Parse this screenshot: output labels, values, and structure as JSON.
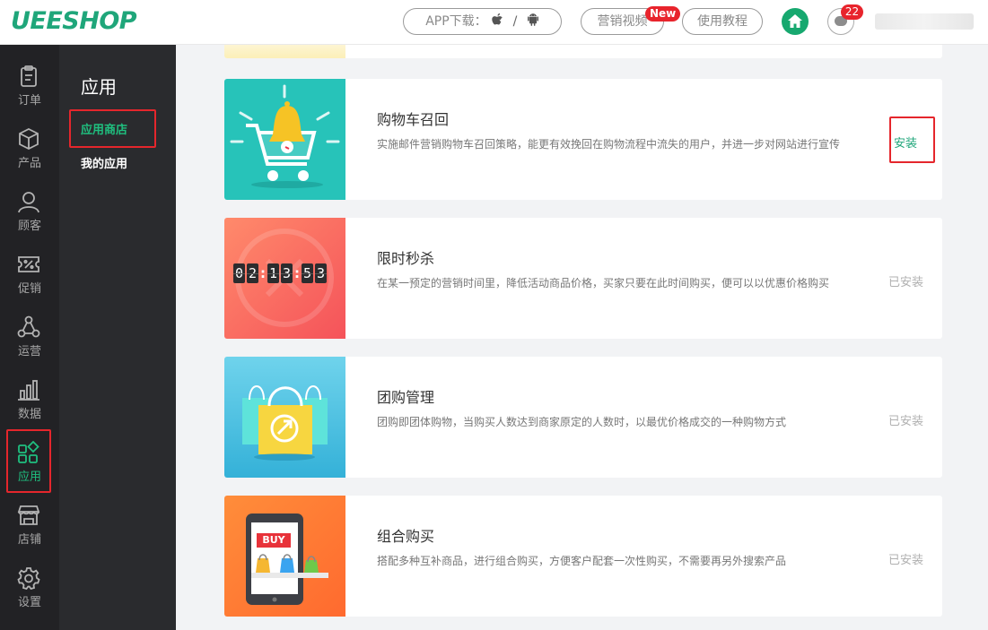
{
  "header": {
    "logo": "UEESHOP",
    "app_download": "APP下载：",
    "app_sep": "/",
    "marketing_video": "营销视频",
    "new_badge": "New",
    "tutorial": "使用教程",
    "message_count": "22"
  },
  "leftnav": [
    {
      "label": "订单",
      "icon": "clipboard-icon"
    },
    {
      "label": "产品",
      "icon": "box-icon"
    },
    {
      "label": "顾客",
      "icon": "user-icon"
    },
    {
      "label": "促销",
      "icon": "percent-ticket-icon"
    },
    {
      "label": "运营",
      "icon": "network-icon"
    },
    {
      "label": "数据",
      "icon": "bar-chart-icon"
    },
    {
      "label": "应用",
      "icon": "apps-icon"
    },
    {
      "label": "店铺",
      "icon": "store-icon"
    },
    {
      "label": "设置",
      "icon": "gear-icon"
    }
  ],
  "subnav": {
    "title": "应用",
    "items": [
      "应用商店",
      "我的应用"
    ]
  },
  "apps": [
    {
      "title": "购物车召回",
      "desc": "实施邮件营销购物车召回策略，能更有效挽回在购物流程中流失的用户，并进一步对网站进行宣传",
      "action": "安装",
      "thumb_color": "#27c3b9"
    },
    {
      "title": "限时秒杀",
      "desc": "在某一预定的营销时间里，降低活动商品价格，买家只要在此时间购买，便可以以优惠价格购买",
      "action": "已安装",
      "thumb_color": "#f7675a",
      "timer": [
        "0",
        "2",
        "1",
        "3",
        "5",
        "3"
      ]
    },
    {
      "title": "团购管理",
      "desc": "团购即团体购物，当购买人数达到商家原定的人数时，以最优价格成交的一种购物方式",
      "action": "已安装",
      "thumb_color": "#45bde0"
    },
    {
      "title": "组合购买",
      "desc": "搭配多种互补商品，进行组合购买，方便客户配套一次性购买，不需要再另外搜索产品",
      "action": "已安装",
      "thumb_color": "#ff7a3d",
      "buy_label": "BUY"
    }
  ]
}
